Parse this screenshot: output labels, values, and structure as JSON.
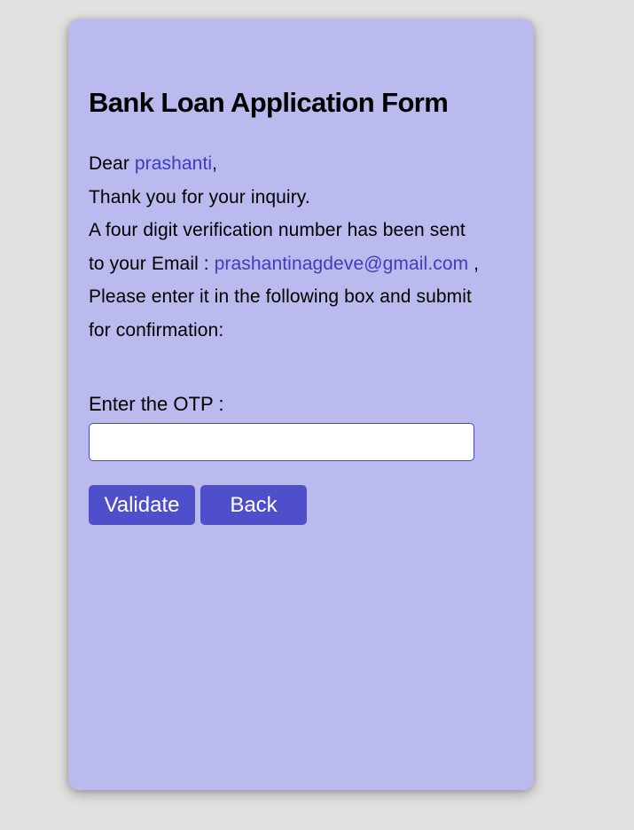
{
  "form": {
    "title": "Bank Loan Application Form",
    "greeting_prefix": "Dear ",
    "user_name": "prashanti",
    "greeting_suffix": ",",
    "thanks_line": "Thank you for your inquiry.",
    "verification_line": "A four digit verification number has been sent",
    "email_prefix": "to your Email : ",
    "email": "prashantinagdeve@gmail.com",
    "email_suffix": " ,",
    "instruction_line_1": "Please enter it in the following box and submit",
    "instruction_line_2": "for confirmation:",
    "otp_label": "Enter the OTP :",
    "otp_value": "",
    "otp_placeholder": ""
  },
  "buttons": {
    "validate_label": "Validate",
    "back_label": "Back"
  },
  "colors": {
    "page_background": "#e2e1df",
    "card_background": "#babaee",
    "accent_text": "#3d3dbf",
    "button_background": "#4f4fcb",
    "input_border": "#4848c6"
  }
}
